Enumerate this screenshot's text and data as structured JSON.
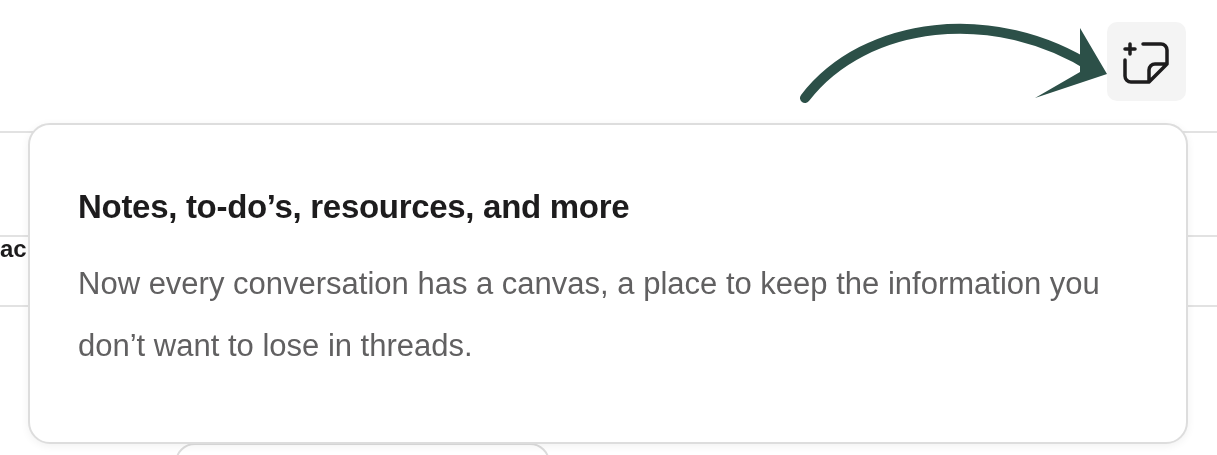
{
  "background_text": "ac",
  "popover": {
    "title": "Notes, to-do’s, resources, and more",
    "body": "Now every conversation has a canvas, a place to keep the information you don’t want to lose in threads."
  }
}
